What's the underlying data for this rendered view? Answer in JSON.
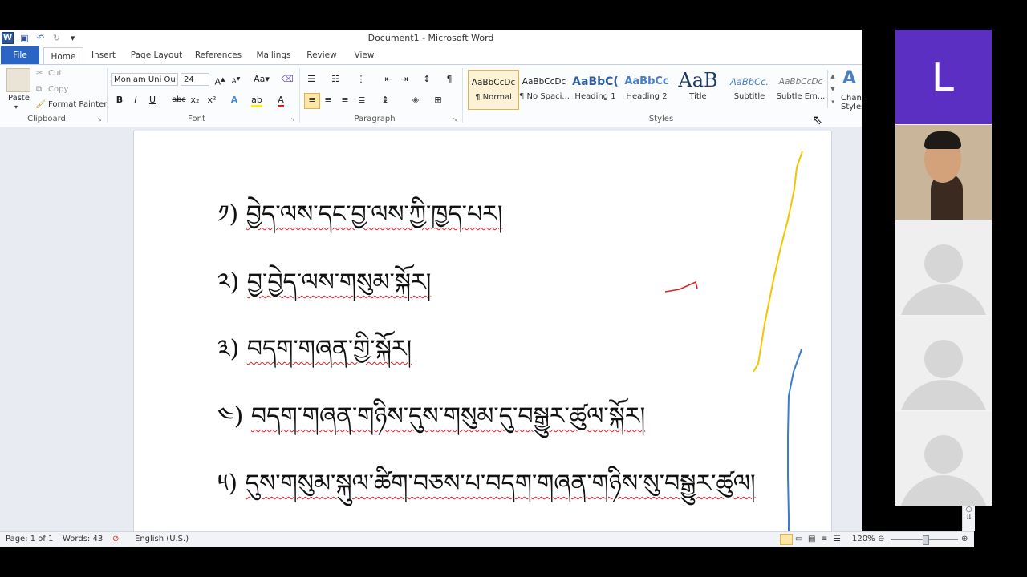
{
  "window": {
    "title": "Document1 - Microsoft Word"
  },
  "qat": {
    "icons": [
      "word-icon",
      "save-icon",
      "undo-icon",
      "redo-icon",
      "customize-icon"
    ]
  },
  "tabs": [
    "File",
    "Home",
    "Insert",
    "Page Layout",
    "References",
    "Mailings",
    "Review",
    "View"
  ],
  "clipboard": {
    "paste": "Paste",
    "cut": "Cut",
    "copy": "Copy",
    "format_painter": "Format Painter",
    "label": "Clipboard"
  },
  "font": {
    "name": "Monlam Uni Ou",
    "size": "24",
    "label": "Font",
    "buttons": [
      "B",
      "I",
      "U",
      "abc",
      "x₂",
      "x²"
    ]
  },
  "paragraph": {
    "label": "Paragraph"
  },
  "styles": {
    "label": "Styles",
    "items": [
      {
        "preview": "AaBbCcDc",
        "name": "¶ Normal"
      },
      {
        "preview": "AaBbCcDc",
        "name": "¶ No Spaci..."
      },
      {
        "preview": "AaBbC(",
        "name": "Heading 1"
      },
      {
        "preview": "AaBbCc",
        "name": "Heading 2"
      },
      {
        "preview": "AaB",
        "name": "Title"
      },
      {
        "preview": "AaBbCc.",
        "name": "Subtitle"
      },
      {
        "preview": "AaBbCcDc",
        "name": "Subtle Em..."
      }
    ],
    "change_styles": "Change Styles"
  },
  "document": {
    "lines": [
      {
        "num": "༡)",
        "text": "བྱེད་ལས་དང་བྱ་ལས་ཀྱི་ཁྱད་པར།"
      },
      {
        "num": "༢)",
        "text": "བྱ་བྱེད་ལས་གསུམ་སྐོར།"
      },
      {
        "num": "༣)",
        "text": "བདག་གཞན་གྱི་སྐོར།"
      },
      {
        "num": "༤)",
        "text": "བདག་གཞན་གཉིས་དུས་གསུམ་དུ་བསྒྱུར་ཚུལ་སྐོར།"
      },
      {
        "num": "༥)",
        "text": "དུས་གསུམ་སྐུལ་ཚིག་བཅས་པ་བདག་གཞན་གཉིས་སུ་བསྒྱུར་ཚུལ།"
      }
    ]
  },
  "status": {
    "page": "Page: 1 of 1",
    "words": "Words: 43",
    "language": "English (U.S.)",
    "zoom": "120%"
  },
  "video": {
    "letter": "L"
  }
}
